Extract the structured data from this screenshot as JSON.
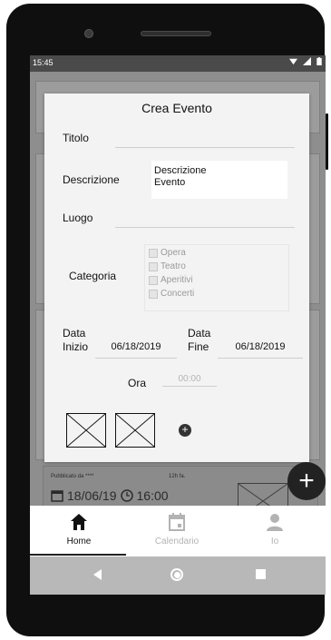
{
  "status_bar": {
    "time": "15:45"
  },
  "modal": {
    "title": "Crea Evento",
    "titolo_label": "Titolo",
    "titolo_value": "",
    "descrizione_label": "Descrizione",
    "descrizione_value": "Descrizione\nEvento",
    "luogo_label": "Luogo",
    "luogo_value": "",
    "categoria_label": "Categoria",
    "categories": [
      "Opera",
      "Teatro",
      "Aperitivi",
      "Concerti"
    ],
    "data_inizio_label_1": "Data",
    "data_inizio_label_2": "Inizio",
    "data_inizio_value": "06/18/2019",
    "data_fine_label_1": "Data",
    "data_fine_label_2": "Fine",
    "data_fine_value": "06/18/2019",
    "ora_label": "Ora",
    "ora_placeholder": "00:00"
  },
  "feed_card": {
    "meta": "Pubblicato da ****",
    "time_ago": "12h fa.",
    "date": "18/06/19",
    "hour": "16:00"
  },
  "bottom_nav": {
    "items": [
      {
        "label": "Home",
        "icon": "home-icon",
        "active": true
      },
      {
        "label": "Calendario",
        "icon": "calendar-icon",
        "active": false
      },
      {
        "label": "Io",
        "icon": "person-icon",
        "active": false
      }
    ]
  },
  "fab_label": "+"
}
